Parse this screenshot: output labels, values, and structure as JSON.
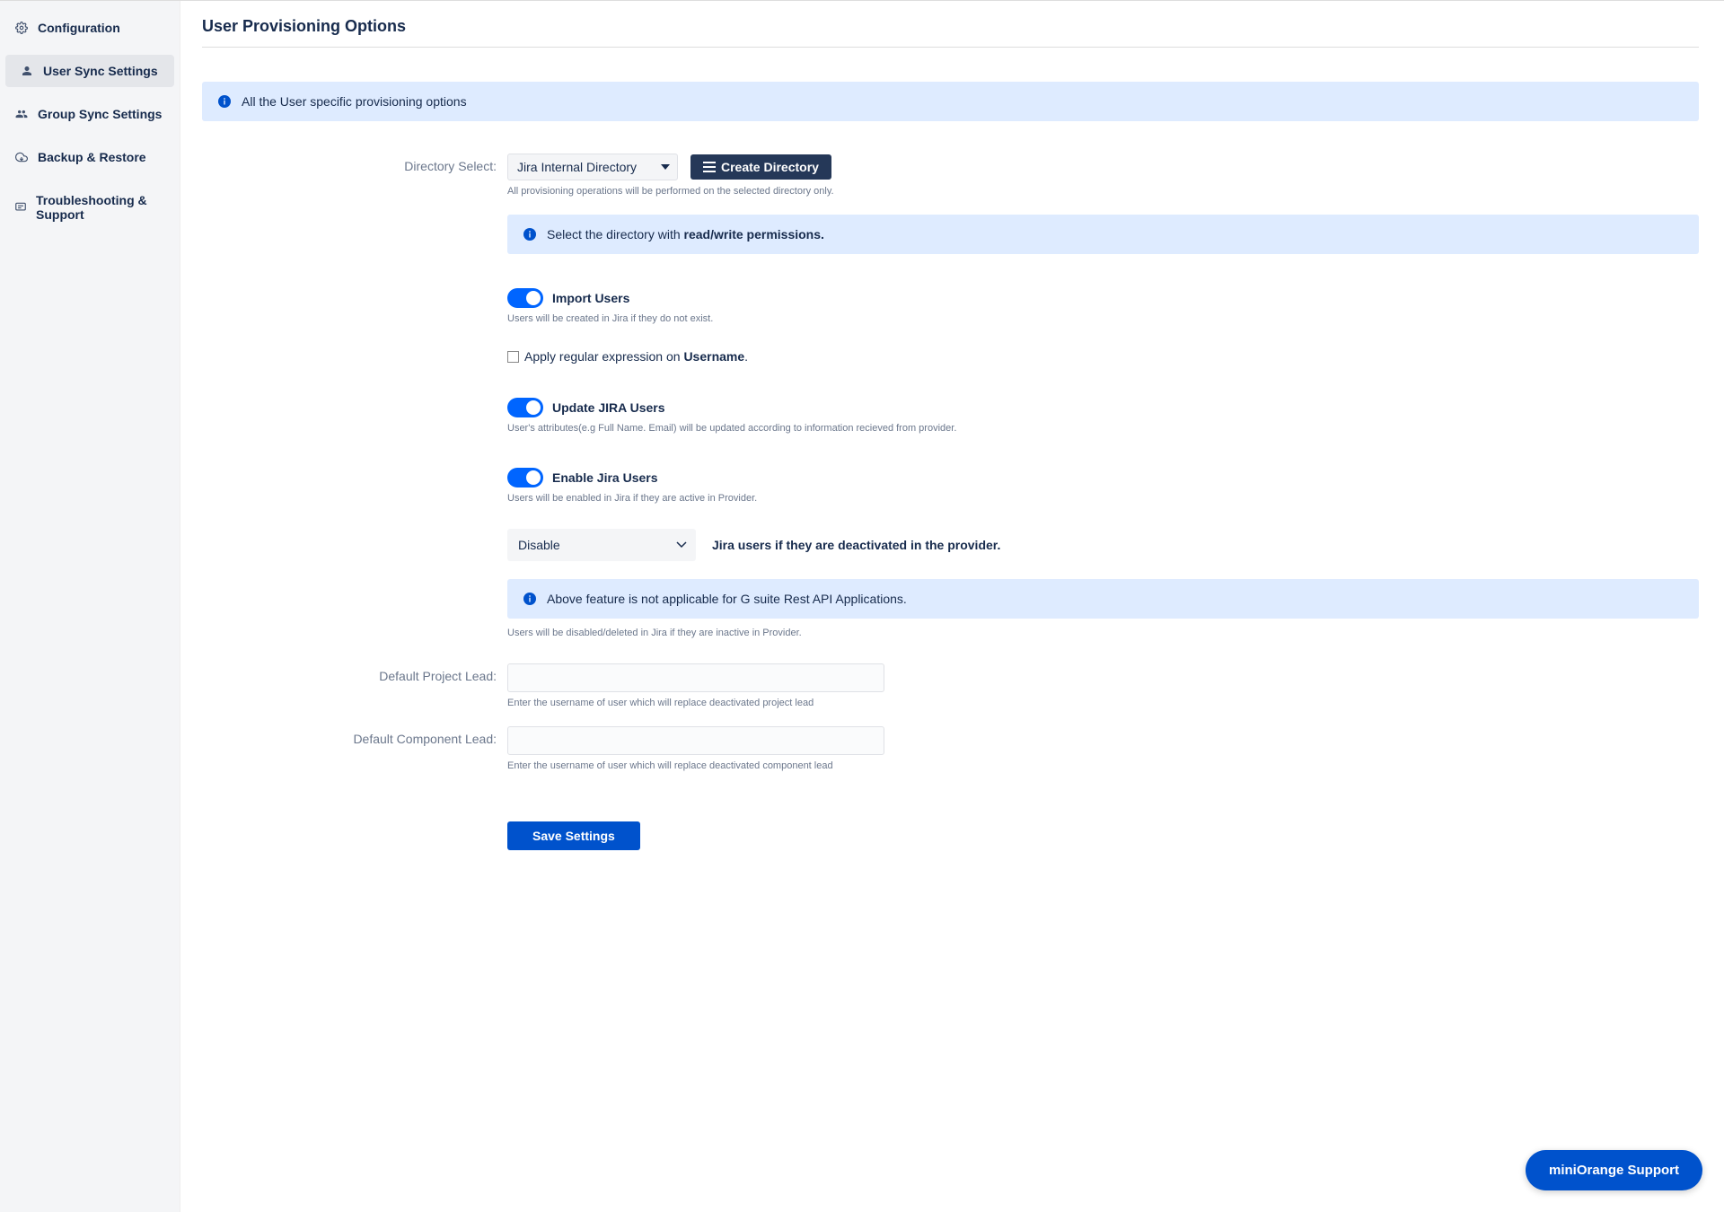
{
  "sidebar": {
    "items": [
      {
        "label": "Configuration"
      },
      {
        "label": "User Sync Settings"
      },
      {
        "label": "Group Sync Settings"
      },
      {
        "label": "Backup & Restore"
      },
      {
        "label": "Troubleshooting & Support"
      }
    ]
  },
  "page": {
    "title": "User Provisioning Options"
  },
  "banners": {
    "top": "All the User specific provisioning options",
    "permissions_prefix": "Select the directory with ",
    "permissions_strong": "read/write permissions.",
    "gsuite": "Above feature is not applicable for G suite Rest API Applications."
  },
  "directory": {
    "label": "Directory Select:",
    "selected": "Jira Internal Directory",
    "create_button": "Create Directory",
    "helper": "All provisioning operations will be performed on the selected directory only."
  },
  "import": {
    "label": "Import Users",
    "helper": "Users will be created in Jira if they do not exist."
  },
  "regex": {
    "prefix": "Apply regular expression on ",
    "strong": "Username",
    "suffix": "."
  },
  "update": {
    "label": "Update JIRA Users",
    "helper": "User's attributes(e.g Full Name. Email) will be updated according to information recieved from provider."
  },
  "enable": {
    "label": "Enable Jira Users",
    "helper": "Users will be enabled in Jira if they are active in Provider."
  },
  "deactivate": {
    "select_value": "Disable",
    "text": "Jira users if they are deactivated in the provider.",
    "helper": "Users will be disabled/deleted in Jira if they are inactive in Provider."
  },
  "project_lead": {
    "label": "Default Project Lead:",
    "value": "",
    "helper": "Enter the username of user which will replace deactivated project lead"
  },
  "component_lead": {
    "label": "Default Component Lead:",
    "value": "",
    "helper": "Enter the username of user which will replace deactivated component lead"
  },
  "save_button": "Save Settings",
  "support_button": "miniOrange Support"
}
